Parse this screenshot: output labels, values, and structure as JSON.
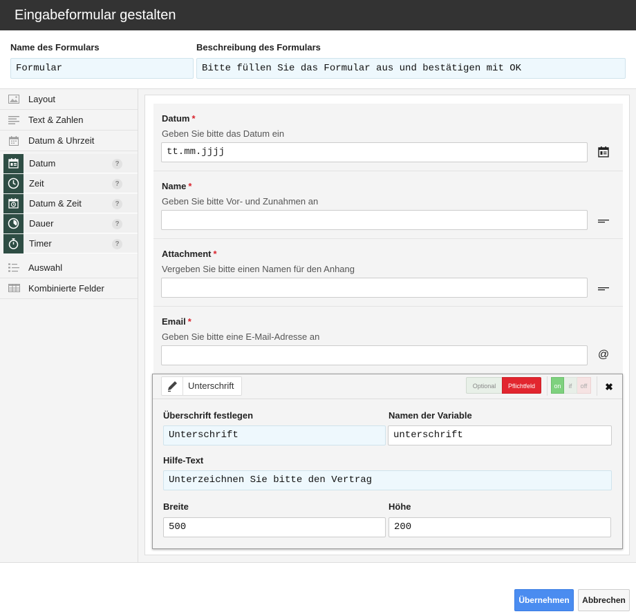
{
  "dialog": {
    "title": "Eingabeformular gestalten"
  },
  "form_meta": {
    "name_label": "Name des Formulars",
    "name_value": "Formular",
    "description_label": "Beschreibung des Formulars",
    "description_value": "Bitte füllen Sie das Formular aus und bestätigen mit OK"
  },
  "sidebar": {
    "categories": [
      {
        "label": "Layout",
        "icon": "image-icon"
      },
      {
        "label": "Text & Zahlen",
        "icon": "text-lines-icon"
      },
      {
        "label": "Datum & Uhrzeit",
        "icon": "calendar-icon"
      },
      {
        "label": "Auswahl",
        "icon": "list-select-icon"
      },
      {
        "label": "Kombinierte Felder",
        "icon": "table-grid-icon"
      }
    ],
    "subitems": [
      {
        "label": "Datum",
        "icon": "calendar-icon",
        "help": "?"
      },
      {
        "label": "Zeit",
        "icon": "clock-icon",
        "help": "?"
      },
      {
        "label": "Datum & Zeit",
        "icon": "calendar-clock-icon",
        "help": "?"
      },
      {
        "label": "Dauer",
        "icon": "clock-icon",
        "help": "?"
      },
      {
        "label": "Timer",
        "icon": "stopwatch-icon",
        "help": "?"
      }
    ]
  },
  "fields": [
    {
      "title": "Datum",
      "required_mark": "*",
      "help": "Geben Sie bitte das Datum ein",
      "value": "tt.mm.jjjj",
      "icon": "calendar-icon"
    },
    {
      "title": "Name",
      "required_mark": "*",
      "help": "Geben Sie bitte Vor- und Zunahmen an",
      "value": "",
      "icon": "text-line-icon"
    },
    {
      "title": "Attachment",
      "required_mark": "*",
      "help": "Vergeben Sie bitte einen Namen für den Anhang",
      "value": "",
      "icon": "text-line-icon"
    },
    {
      "title": "Email",
      "required_mark": "*",
      "help": "Geben Sie bitte eine E-Mail-Adresse an",
      "value": "",
      "icon_text": "@"
    }
  ],
  "editor": {
    "type_label": "Unterschrift",
    "optional_label": "Optional",
    "required_label": "Pflichtfeld",
    "toggle_on": "on",
    "toggle_if": "if",
    "toggle_off": "off",
    "close_symbol": "✖",
    "heading_label": "Überschrift festlegen",
    "heading_value": "Unterschrift",
    "variable_label": "Namen der Variable",
    "variable_value": "unterschrift",
    "help_label": "Hilfe-Text",
    "help_value": "Unterzeichnen Sie bitte den Vertrag",
    "width_label": "Breite",
    "width_value": "500",
    "height_label": "Höhe",
    "height_value": "200"
  },
  "footer": {
    "apply_label": "Übernehmen",
    "cancel_label": "Abbrechen"
  },
  "colors": {
    "titlebar": "#333333",
    "sidebar_icon_bg": "#2e4d44",
    "required": "#d9232d",
    "primary_button": "#4a8cf0",
    "toggle_on": "#7ed17e"
  }
}
